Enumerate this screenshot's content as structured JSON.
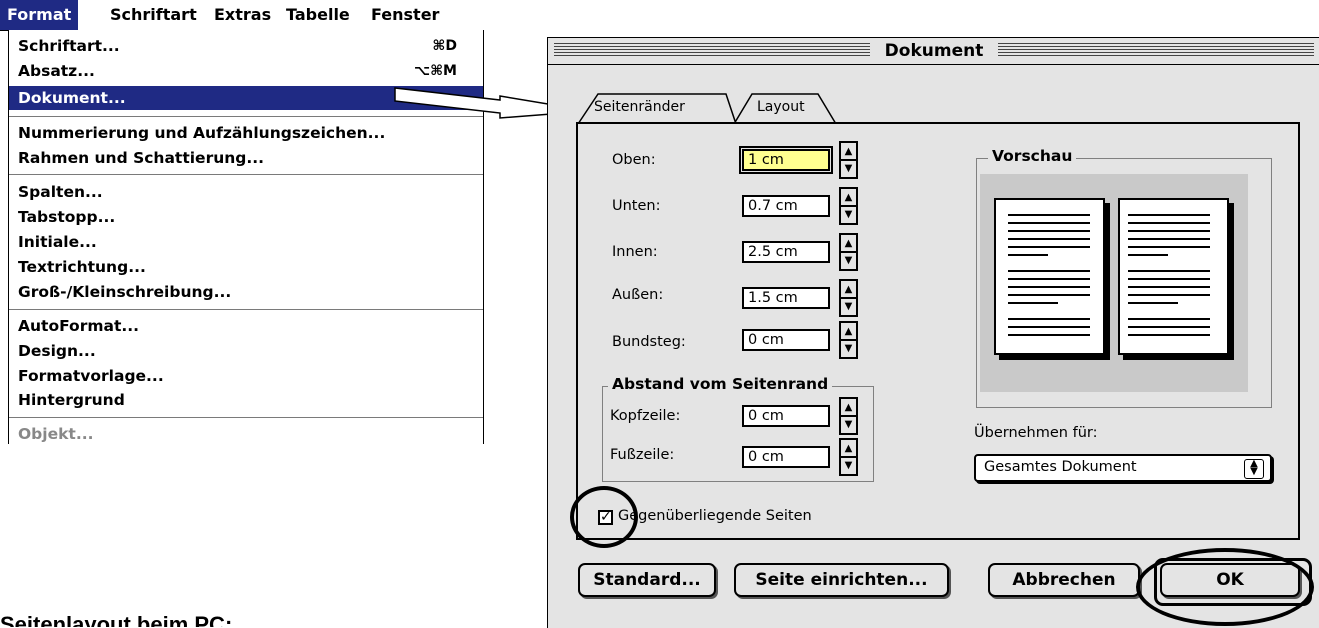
{
  "menubar": {
    "items": [
      "Format",
      "Schriftart",
      "Extras",
      "Tabelle",
      "Fenster"
    ]
  },
  "menu": {
    "items": [
      {
        "label": "Schriftart...",
        "shortcut": "⌘D"
      },
      {
        "label": "Absatz...",
        "shortcut": "⌥⌘M"
      },
      {
        "label": "Dokument...",
        "shortcut": "",
        "highlighted": true
      },
      {
        "label": "Nummerierung und Aufzählungszeichen...",
        "shortcut": ""
      },
      {
        "label": "Rahmen und Schattierung...",
        "shortcut": ""
      },
      {
        "label": "Spalten...",
        "shortcut": ""
      },
      {
        "label": "Tabstopp...",
        "shortcut": ""
      },
      {
        "label": "Initiale...",
        "shortcut": ""
      },
      {
        "label": "Textrichtung...",
        "shortcut": ""
      },
      {
        "label": "Groß-/Kleinschreibung...",
        "shortcut": ""
      },
      {
        "label": "AutoFormat...",
        "shortcut": ""
      },
      {
        "label": "Design...",
        "shortcut": ""
      },
      {
        "label": "Formatvorlage...",
        "shortcut": ""
      },
      {
        "label": "Hintergrund",
        "shortcut": ""
      },
      {
        "label": "Objekt...",
        "shortcut": "",
        "disabled": true
      }
    ]
  },
  "dialog": {
    "title": "Dokument",
    "tabs": [
      "Seitenränder",
      "Layout"
    ],
    "fields": {
      "oben": {
        "label": "Oben:",
        "value": "1 cm"
      },
      "unten": {
        "label": "Unten:",
        "value": "0.7 cm"
      },
      "innen": {
        "label": "Innen:",
        "value": "2.5 cm"
      },
      "aussen": {
        "label": "Außen:",
        "value": "1.5 cm"
      },
      "bundsteg": {
        "label": "Bundsteg:",
        "value": "0 cm"
      }
    },
    "abstand_group": {
      "title": "Abstand vom Seitenrand",
      "kopfzeile": {
        "label": "Kopfzeile:",
        "value": "0 cm"
      },
      "fusszeile": {
        "label": "Fußzeile:",
        "value": "0 cm"
      }
    },
    "preview_title": "Vorschau",
    "apply_label": "Übernehmen für:",
    "apply_value": "Gesamtes Dokument",
    "checkbox_label": "Gegenüberliegende Seiten",
    "checkbox_checked": true,
    "buttons": {
      "standard": "Standard...",
      "seite": "Seite einrichten...",
      "abbrechen": "Abbrechen",
      "ok": "OK"
    }
  },
  "caption": "Seitenlayout beim PC:",
  "colors": {
    "highlight": "#1f2a84",
    "focus_field": "#ffff90",
    "dialog_bg": "#e4e4e4"
  }
}
